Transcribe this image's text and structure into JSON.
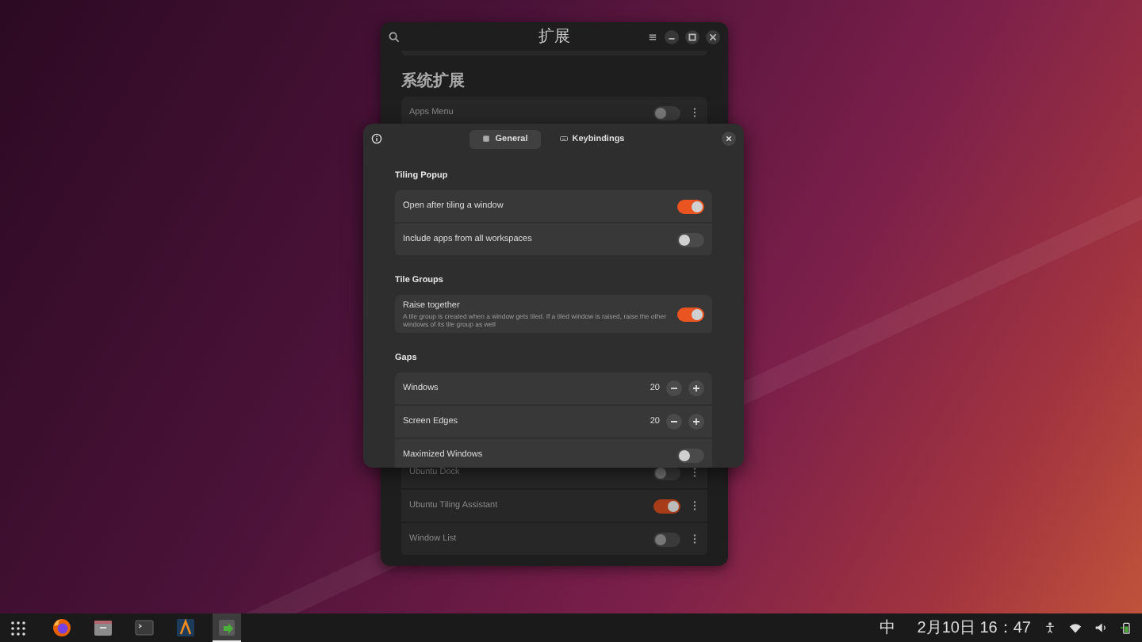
{
  "background_window": {
    "title": "扩展",
    "section_title": "系统扩展",
    "extensions": [
      {
        "name": "Apps Menu",
        "enabled": false
      },
      {
        "name": "Ubuntu Dock",
        "enabled": false
      },
      {
        "name": "Ubuntu Tiling Assistant",
        "enabled": true
      },
      {
        "name": "Window List",
        "enabled": false
      }
    ]
  },
  "dialog": {
    "tabs": [
      {
        "label": "General",
        "selected": true
      },
      {
        "label": "Keybindings",
        "selected": false
      }
    ],
    "sections": [
      {
        "title": "Tiling Popup",
        "rows": [
          {
            "kind": "switch",
            "label": "Open after tiling a window",
            "on": true
          },
          {
            "kind": "switch",
            "label": "Include apps from all workspaces",
            "on": false
          }
        ]
      },
      {
        "title": "Tile Groups",
        "rows": [
          {
            "kind": "switch",
            "label": "Raise together",
            "description": "A tile group is created when a window gets tiled. If a tiled window is raised, raise the other windows of its tile group as well",
            "on": true
          }
        ]
      },
      {
        "title": "Gaps",
        "rows": [
          {
            "kind": "spin",
            "label": "Windows",
            "value": "20"
          },
          {
            "kind": "spin",
            "label": "Screen Edges",
            "value": "20"
          },
          {
            "kind": "switch",
            "label": "Maximized Windows",
            "on": false
          }
        ]
      }
    ]
  },
  "taskbar": {
    "apps": [
      {
        "kind": "browser",
        "focused": false
      },
      {
        "kind": "files",
        "focused": false
      },
      {
        "kind": "terminal",
        "focused": false
      },
      {
        "kind": "editor",
        "focused": false
      },
      {
        "kind": "extensions",
        "focused": true
      }
    ],
    "input_method": "中",
    "clock": "2月10日 16：47"
  }
}
